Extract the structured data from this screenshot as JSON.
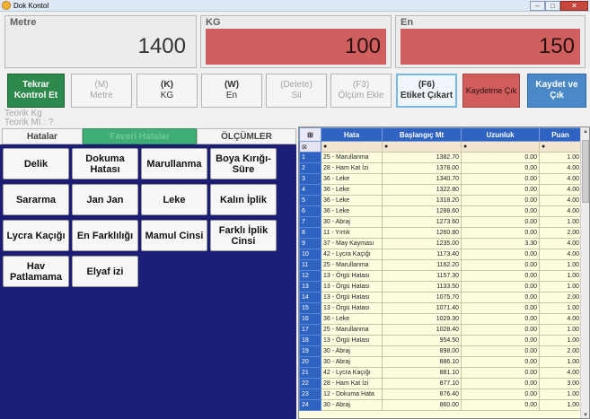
{
  "window": {
    "title": "Dok Kontol",
    "min": "‒",
    "max": "□",
    "close": "✕"
  },
  "panels": {
    "metre": {
      "label": "Metre",
      "value": "1400"
    },
    "kg": {
      "label": "KG",
      "value": "100"
    },
    "en": {
      "label": "En",
      "value": "150"
    }
  },
  "buttons": {
    "tekrar": {
      "l1": "Tekrar",
      "l2": "Kontrol Et"
    },
    "metre": {
      "l1": "(M)",
      "l2": "Metre"
    },
    "kg": {
      "l1": "(K)",
      "l2": "KG"
    },
    "en": {
      "l1": "(W)",
      "l2": "En"
    },
    "sil": {
      "l1": "(Delete)",
      "l2": "Sil"
    },
    "olcum": {
      "l1": "(F3)",
      "l2": "Ölçüm Ekle"
    },
    "etiket": {
      "l1": "(F6)",
      "l2": "Etiket Çıkart"
    },
    "kaydetme": {
      "l1": "Kaydetme Çık"
    },
    "kaydet": {
      "l1": "Kaydet ve",
      "l2": "Çık"
    }
  },
  "teorik": {
    "kg": "Teorik Kg",
    "mt": "Teorik Mt : ?"
  },
  "tabs": [
    "Hatalar",
    "Favori Hatalar",
    "ÖLÇÜMLER"
  ],
  "errors": [
    "Delik",
    "Dokuma Hatası",
    "Marullanma",
    "Boya Kırığı-Süre",
    "Sararma",
    "Jan Jan",
    "Leke",
    "Kalın İplik",
    "Lycra Kaçığı",
    "En Farklılığı",
    "Mamul Cinsi",
    "Farklı İplik Cinsi",
    "Hav Patlamama",
    "Elyaf izi"
  ],
  "grid": {
    "columns": [
      "Hata",
      "Başlangıç Mt",
      "Uzunluk",
      "Puan"
    ],
    "filter_marker": "●",
    "rows": [
      [
        "1",
        "25 - Marullanma",
        "1382.70",
        "0.00",
        "1.00"
      ],
      [
        "2",
        "28 - Ham Kat İzi",
        "1378.00",
        "0.00",
        "4.00"
      ],
      [
        "3",
        "36 - Leke",
        "1340.70",
        "0.00",
        "4.00"
      ],
      [
        "4",
        "36 - Leke",
        "1322.80",
        "0.00",
        "4.00"
      ],
      [
        "5",
        "36 - Leke",
        "1318.20",
        "0.00",
        "4.00"
      ],
      [
        "6",
        "36 - Leke",
        "1288.60",
        "0.00",
        "4.00"
      ],
      [
        "7",
        "30 - Abraj",
        "1273.60",
        "0.00",
        "1.00"
      ],
      [
        "8",
        "11 - Yırtık",
        "1260.80",
        "0.00",
        "2.00"
      ],
      [
        "9",
        "37 - May Kayması",
        "1235.00",
        "3.30",
        "4.00"
      ],
      [
        "10",
        "42 - Lycra Kaçığı",
        "1173.40",
        "0.00",
        "4.00"
      ],
      [
        "11",
        "25 - Marullanma",
        "1162.20",
        "0.00",
        "1.00"
      ],
      [
        "12",
        "13 - Örgü Hatası",
        "1157.30",
        "0.00",
        "1.00"
      ],
      [
        "13",
        "13 - Örgü Hatası",
        "1133.50",
        "0.00",
        "1.00"
      ],
      [
        "14",
        "13 - Örgü Hatası",
        "1075.70",
        "0.00",
        "2.00"
      ],
      [
        "15",
        "13 - Örgü Hatası",
        "1071.40",
        "0.00",
        "1.00"
      ],
      [
        "16",
        "36 - Leke",
        "1029.30",
        "0.00",
        "4.00"
      ],
      [
        "17",
        "25 - Marullanma",
        "1028.40",
        "0.00",
        "1.00"
      ],
      [
        "18",
        "13 - Örgü Hatası",
        "954.50",
        "0.00",
        "1.00"
      ],
      [
        "19",
        "30 - Abraj",
        "898.00",
        "0.00",
        "2.00"
      ],
      [
        "20",
        "30 - Abraj",
        "886.10",
        "0.00",
        "1.00"
      ],
      [
        "21",
        "42 - Lycra Kaçığı",
        "881.10",
        "0.00",
        "4.00"
      ],
      [
        "22",
        "28 - Ham Kat İzi",
        "877.10",
        "0.00",
        "3.00"
      ],
      [
        "23",
        "12 - Dokuma Hata",
        "876.40",
        "0.00",
        "1.00"
      ],
      [
        "24",
        "30 - Abraj",
        "860.00",
        "0.00",
        "1.00"
      ]
    ]
  },
  "colors": {
    "error_panel": "#1b1e74",
    "grid_header": "#2f63c2",
    "red_value": "#d06060",
    "green_button": "#2e8a4c"
  }
}
